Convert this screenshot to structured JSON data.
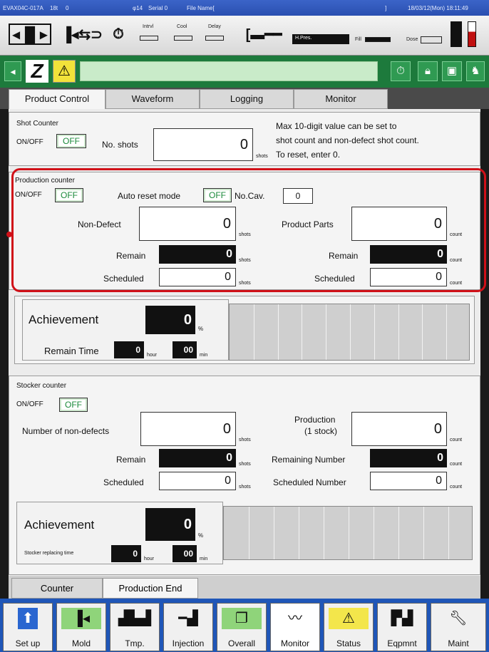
{
  "status_bar": {
    "machine": "EVAX04C-017A",
    "num1": "18t",
    "num2": "0",
    "screw": "φ14",
    "serial": "Serial 0",
    "file_name": "File Name[",
    "bracket": "]",
    "datetime": "18/03/12(Mon) 18:11:49"
  },
  "icon_bar": {
    "intrvl": "Intrvl",
    "cool": "Cool",
    "delay": "Delay",
    "hpres": "H.Pres.",
    "fill": "Fill",
    "dose": "Dose"
  },
  "tabs": [
    "Product Control",
    "Waveform",
    "Logging",
    "Monitor"
  ],
  "shot_counter": {
    "title": "Shot Counter",
    "onoff_label": "ON/OFF",
    "onoff_value": "OFF",
    "shots_label": "No. shots",
    "shots_value": "0",
    "unit": "shots",
    "note_1": "Max 10-digit value can be set to",
    "note_2": "shot count and non-defect shot count.",
    "note_3": "To reset, enter 0."
  },
  "production_counter": {
    "title": "Production counter",
    "onoff_label": "ON/OFF",
    "onoff_value": "OFF",
    "auto_reset_label": "Auto reset mode",
    "auto_reset_value": "OFF",
    "cav_label": "No.Cav.",
    "cav_value": "0",
    "non_defect_label": "Non-Defect",
    "non_defect_value": "0",
    "remain_label": "Remain",
    "remain_value": "0",
    "scheduled_label": "Scheduled",
    "scheduled_value": "0",
    "parts_label": "Product Parts",
    "parts_value": "0",
    "parts_remain_label": "Remain",
    "parts_remain_value": "0",
    "parts_scheduled_label": "Scheduled",
    "parts_scheduled_value": "0",
    "unit_shots": "shots",
    "unit_count": "count"
  },
  "achievement_1": {
    "label": "Achievement",
    "value": "0",
    "pct": "%",
    "remain_time_label": "Remain Time",
    "hour_value": "0",
    "hour_unit": "hour",
    "min_value": "00",
    "min_unit": "min"
  },
  "stocker_counter": {
    "title": "Stocker counter",
    "onoff_label": "ON/OFF",
    "onoff_value": "OFF",
    "non_defects_label": "Number of non-defects",
    "non_defects_value": "0",
    "remain_label": "Remain",
    "remain_value": "0",
    "scheduled_label": "Scheduled",
    "scheduled_value": "0",
    "production_label_1": "Production",
    "production_label_2": "(1 stock)",
    "production_value": "0",
    "remaining_number_label": "Remaining Number",
    "remaining_number_value": "0",
    "scheduled_number_label": "Scheduled Number",
    "scheduled_number_value": "0",
    "unit_shots": "shots",
    "unit_count": "count"
  },
  "achievement_2": {
    "label": "Achievement",
    "value": "0",
    "pct": "%",
    "replace_label": "Stocker replacing time",
    "hour_value": "0",
    "hour_unit": "hour",
    "min_value": "00",
    "min_unit": "min"
  },
  "sub_tabs": [
    "Counter",
    "Production End"
  ],
  "bottom_nav": [
    "Set up",
    "Mold",
    "Tmp.",
    "Injection",
    "Overall",
    "Monitor",
    "Status",
    "Eqpmnt",
    "Maint"
  ],
  "colors": {
    "highlight": "#d01018",
    "toggle_text": "#1a8a3a",
    "nav_bg": "#1f56b8",
    "green_bar": "#1d7a3c"
  }
}
